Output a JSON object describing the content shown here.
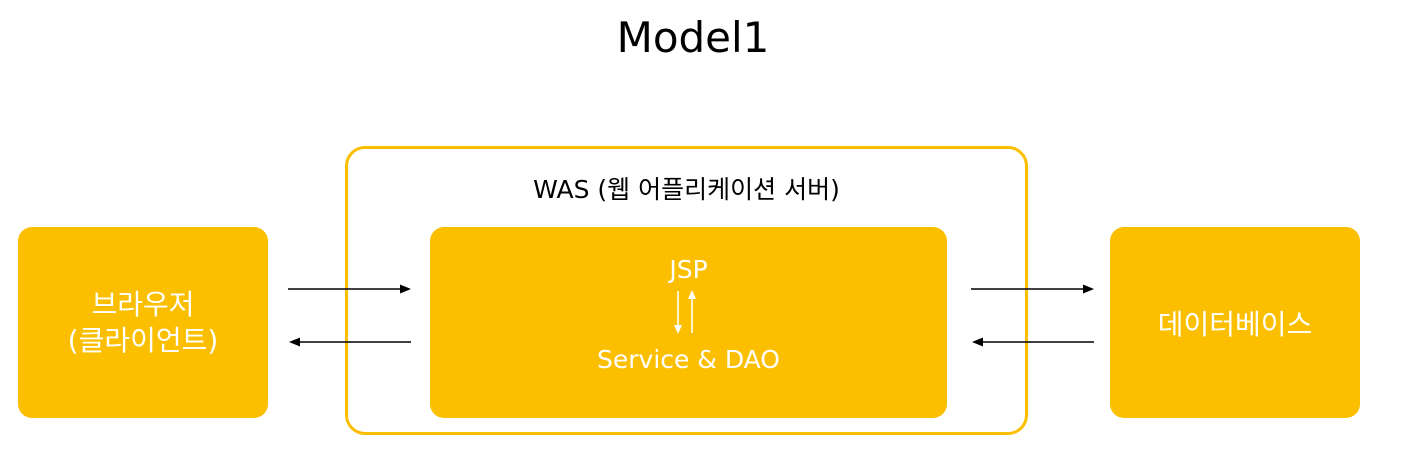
{
  "title": "Model1",
  "browser": {
    "line1": "브라우저",
    "line2": "(클라이언트)"
  },
  "was": {
    "label": "WAS (웹 어플리케이션 서버)",
    "jsp": "JSP",
    "service": "Service & DAO"
  },
  "database": {
    "label": "데이터베이스"
  },
  "colors": {
    "box_fill": "#fbbf00",
    "box_text": "#ffffff",
    "arrow": "#000000"
  }
}
